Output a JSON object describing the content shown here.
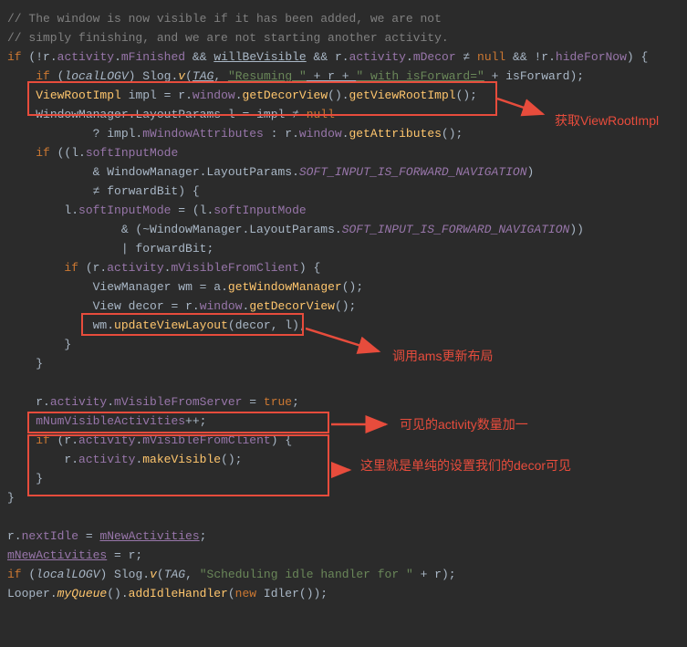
{
  "code": {
    "l1": "// The window is now visible if it has been added, we are not",
    "l2": "// simply finishing, and we are not starting another activity.",
    "l3_if": "if",
    "l3_r": "r",
    "l3_activity": "activity",
    "l3_finished": "mFinished",
    "l3_willbe": "willBeVisible",
    "l3_mdecor": "mDecor",
    "l3_null": "null",
    "l3_hide": "hideForNow",
    "l4_if": "if",
    "l4_local": "localLOGV",
    "l4_slog": "Slog",
    "l4_v": "v",
    "l4_tag": "TAG",
    "l4_str1": "\"Resuming \"",
    "l4_str2": "\" with isForward=\"",
    "l4_isf": "isForward",
    "l5_type": "ViewRootImpl",
    "l5_impl": "impl",
    "l5_window": "window",
    "l5_getdecor": "getDecorView",
    "l5_getvri": "getViewRootImpl",
    "l6_wlp": "WindowManager.LayoutParams",
    "l6_l": "l",
    "l6_null": "null",
    "l7_mwa": "mWindowAttributes",
    "l7_getattr": "getAttributes",
    "l8_sim": "softInputMode",
    "l9_wlp": "WindowManager.LayoutParams",
    "l9_const": "SOFT_INPUT_IS_FORWARD_NAVIGATION",
    "l10_fb": "forwardBit",
    "l11_sim": "softInputMode",
    "l12_wlp": "WindowManager.LayoutParams",
    "l12_const": "SOFT_INPUT_IS_FORWARD_NAVIGATION",
    "l13_fb": "forwardBit",
    "l14_vfc": "mVisibleFromClient",
    "l15_vm": "ViewManager",
    "l15_wm": "wm",
    "l15_a": "a",
    "l15_gwm": "getWindowManager",
    "l16_view": "View",
    "l16_decor": "decor",
    "l16_gdv": "getDecorView",
    "l17_uvl": "updateViewLayout",
    "l20_vfs": "mVisibleFromServer",
    "l20_true": "true",
    "l21_nva": "mNumVisibleActivities",
    "l22_vfc": "mVisibleFromClient",
    "l23_mv": "makeVisible",
    "l27_ni": "nextIdle",
    "l27_na": "mNewActivities",
    "l28_na": "mNewActivities",
    "l29_local": "localLOGV",
    "l29_str": "\"Scheduling idle handler for \"",
    "l30_looper": "Looper",
    "l30_mq": "myQueue",
    "l30_aih": "addIdleHandler",
    "l30_new": "new",
    "l30_idler": "Idler"
  },
  "annotations": {
    "a1": "获取ViewRootImpl",
    "a2": "调用ams更新布局",
    "a3": "可见的activity数量加一",
    "a4": "这里就是单纯的设置我们的decor可见"
  }
}
